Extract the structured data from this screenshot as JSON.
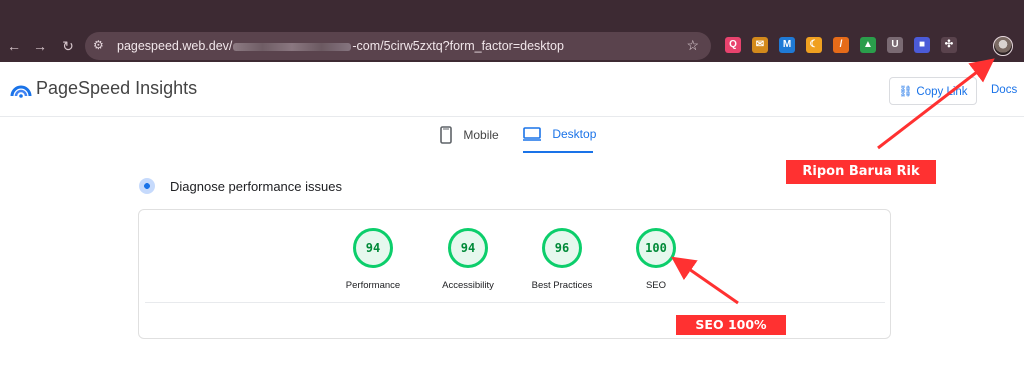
{
  "browser": {
    "url_prefix": "pagespeed.web.dev/",
    "url_suffix": "-com/5cirw5zxtq?form_factor=desktop",
    "back_icon": "arrow-left-icon",
    "forward_icon": "arrow-right-icon",
    "reload_icon": "reload-icon",
    "bookmark_icon": "star-icon",
    "extensions": [
      {
        "name": "ext-red-q",
        "glyph": "Q",
        "color": "#e8436e"
      },
      {
        "name": "ext-mail",
        "glyph": "✉",
        "color": "#d38a1c"
      },
      {
        "name": "ext-m",
        "glyph": "M",
        "color": "#1f7ad6"
      },
      {
        "name": "ext-orange-moon",
        "glyph": "☾",
        "color": "#f0a020"
      },
      {
        "name": "ext-slash",
        "glyph": "/",
        "color": "#e66b19"
      },
      {
        "name": "ext-drive",
        "glyph": "▲",
        "color": "#2a9d4b"
      },
      {
        "name": "ext-u",
        "glyph": "U",
        "color": "#7a6a73"
      },
      {
        "name": "ext-blue-square",
        "glyph": "■",
        "color": "#4b5bd8"
      },
      {
        "name": "ext-puzzle",
        "glyph": "✣",
        "color": "#5a434d"
      }
    ]
  },
  "header": {
    "title": "PageSpeed Insights",
    "copy_link": "Copy Link",
    "docs": "Docs"
  },
  "tabs": [
    {
      "label": "Mobile",
      "active": false
    },
    {
      "label": "Desktop",
      "active": true
    }
  ],
  "diagnose": {
    "title": "Diagnose performance issues",
    "scores": [
      {
        "label": "Performance",
        "value": "94"
      },
      {
        "label": "Accessibility",
        "value": "94"
      },
      {
        "label": "Best Practices",
        "value": "96"
      },
      {
        "label": "SEO",
        "value": "100"
      }
    ]
  },
  "annotations": {
    "name_label": "Ripon Barua Rik",
    "seo_label": "SEO 100%"
  },
  "colors": {
    "score_good": "#0cce6b",
    "accent": "#1a73e8",
    "annotation": "#ff3131"
  }
}
